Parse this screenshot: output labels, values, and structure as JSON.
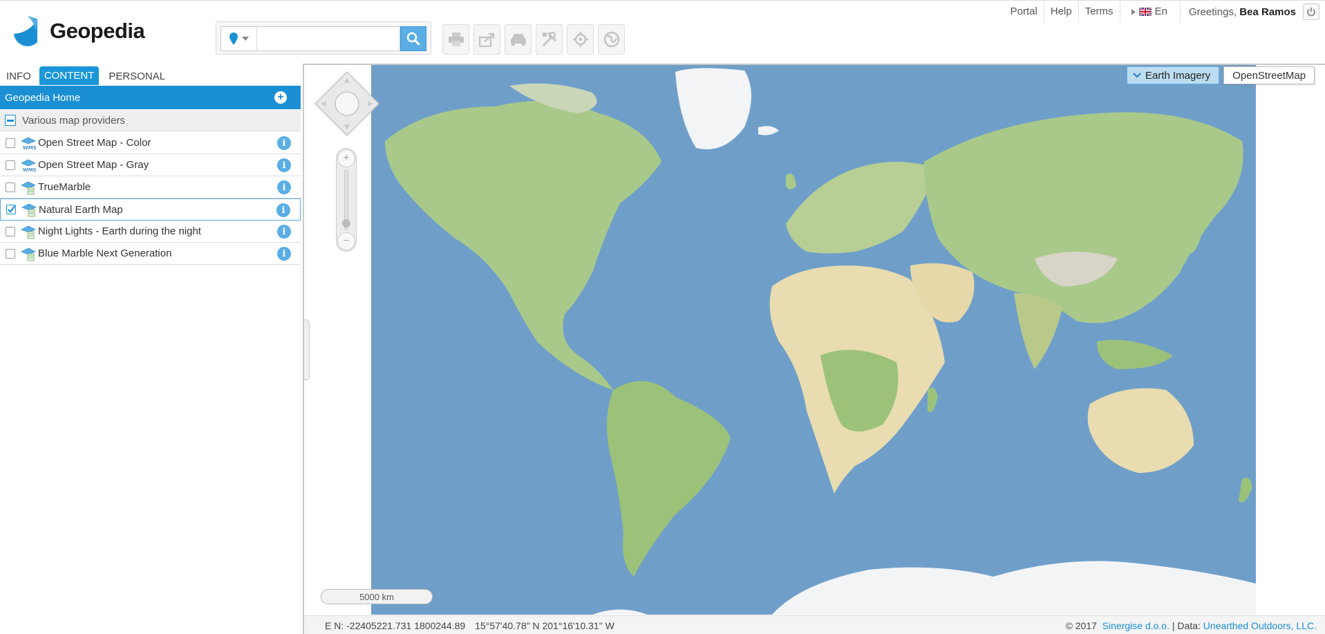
{
  "header": {
    "logo_text": "Geopedia",
    "search": {
      "value": "",
      "placeholder": ""
    },
    "toolbar_icons": [
      "print-icon",
      "share-icon",
      "car-icon",
      "tools-icon",
      "locate-icon",
      "globe-icon"
    ],
    "nav": {
      "portal": "Portal",
      "help": "Help",
      "terms": "Terms",
      "language": "En",
      "greeting_prefix": "Greetings,",
      "user_name": "Bea Ramos"
    }
  },
  "sidebar": {
    "tabs": [
      {
        "label": "INFO",
        "active": false
      },
      {
        "label": "CONTENT",
        "active": true
      },
      {
        "label": "PERSONAL",
        "active": false
      }
    ],
    "panel_title": "Geopedia Home",
    "group_label": "Various map providers",
    "layers": [
      {
        "label": "Open Street Map - Color",
        "checked": false,
        "icon": "wms-layer-icon"
      },
      {
        "label": "Open Street Map - Gray",
        "checked": false,
        "icon": "wms-layer-icon"
      },
      {
        "label": "TrueMarble",
        "checked": false,
        "icon": "raster-layer-icon"
      },
      {
        "label": "Natural Earth Map",
        "checked": true,
        "icon": "raster-layer-icon"
      },
      {
        "label": "Night Lights - Earth during the night",
        "checked": false,
        "icon": "raster-layer-icon"
      },
      {
        "label": "Blue Marble Next Generation",
        "checked": false,
        "icon": "raster-layer-icon"
      }
    ]
  },
  "map": {
    "base_layers": {
      "active": "Earth Imagery",
      "other": "OpenStreetMap"
    },
    "scale_label": "5000 km",
    "coordinates": {
      "en": "E N: -22405221.731 1800244.89",
      "geo": "15°57'40.78\" N 201°16'10.31\" W"
    },
    "copyright": {
      "prefix": "© 2017",
      "company": "Sinergise d.o.o.",
      "data_prefix": "| Data:",
      "data_source": "Unearthed Outdoors, LLC."
    },
    "colors": {
      "ocean": "#6f9fc9",
      "land": "#a9c98a",
      "desert": "#e8dcb0",
      "ice": "#f2f4f6"
    }
  },
  "theme": {
    "accent": "#1a8fd4",
    "accent_light": "#5aaee5"
  }
}
